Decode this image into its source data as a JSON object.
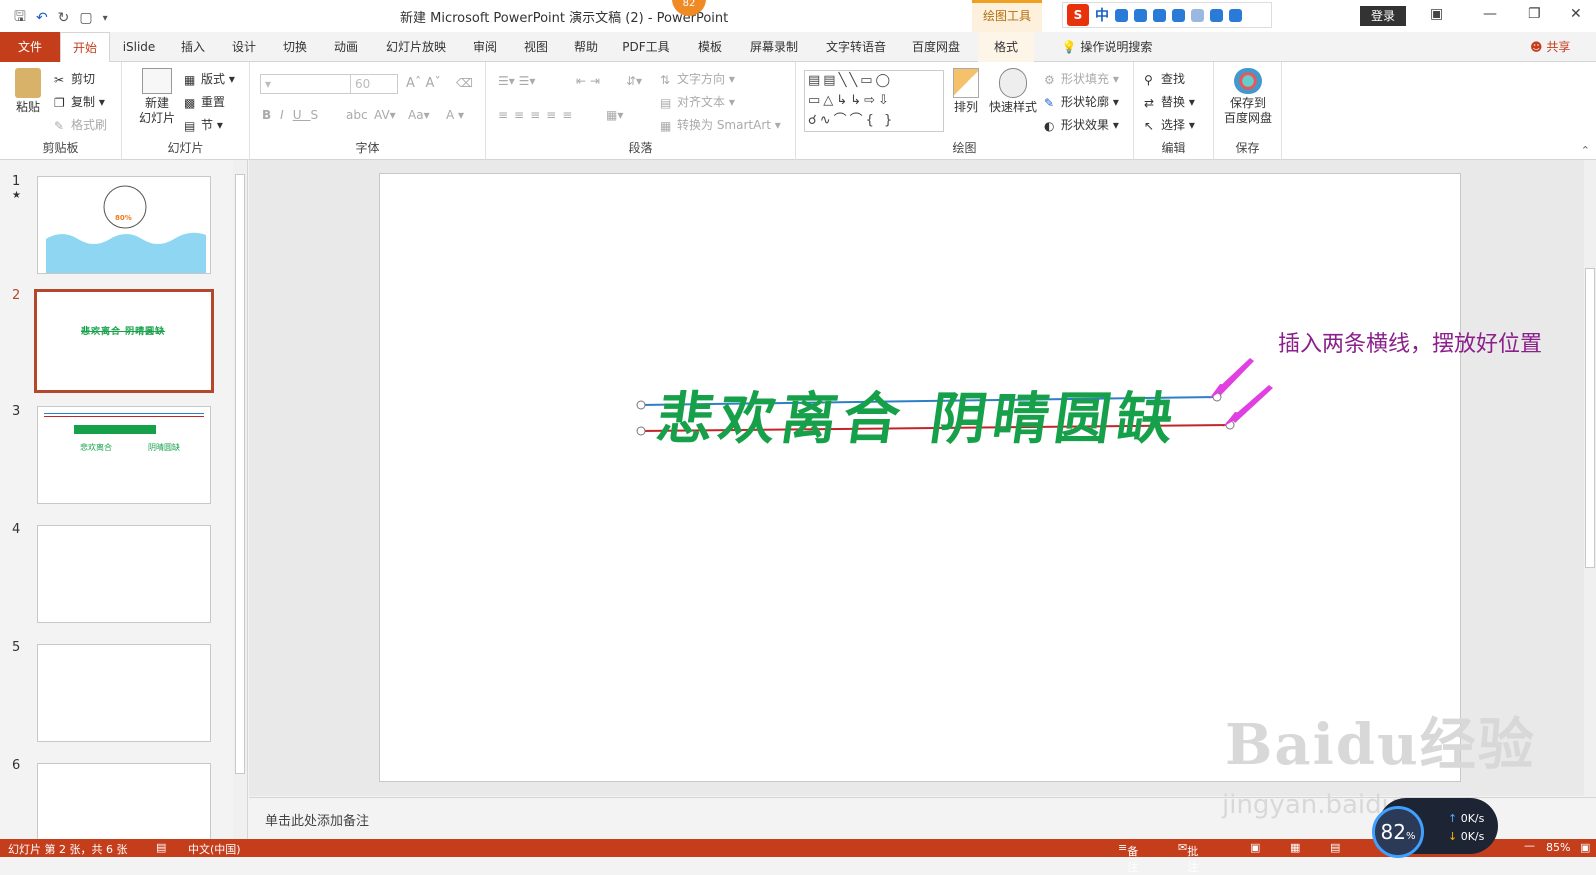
{
  "title_bar": {
    "document_title": "新建 Microsoft PowerPoint 演示文稿 (2)  -  PowerPoint",
    "badge": "82",
    "tool_context_tab": "绘图工具",
    "login_label": "登录",
    "ime_brand": "S",
    "ime_mode": "中"
  },
  "menu": {
    "tabs": [
      "文件",
      "开始",
      "iSlide",
      "插入",
      "设计",
      "切换",
      "动画",
      "幻灯片放映",
      "审阅",
      "视图",
      "帮助",
      "PDF工具",
      "模板",
      "屏幕录制",
      "文字转语音",
      "百度网盘",
      "格式"
    ],
    "active": "开始",
    "tell_me": "操作说明搜索",
    "share": "共享"
  },
  "ribbon": {
    "clipboard": {
      "label": "剪贴板",
      "paste": "粘贴",
      "cut": "剪切",
      "copy": "复制",
      "format_painter": "格式刷"
    },
    "slides": {
      "label": "幻灯片",
      "new_slide": "新建\n幻灯片",
      "layout": "版式",
      "reset": "重置",
      "section": "节"
    },
    "font": {
      "label": "字体",
      "size_value": "60"
    },
    "paragraph": {
      "label": "段落",
      "text_direction": "文字方向",
      "align_text": "对齐文本",
      "convert_smartart": "转换为 SmartArt"
    },
    "drawing": {
      "label": "绘图",
      "arrange": "排列",
      "quick_styles": "快速样式",
      "shape_fill": "形状填充",
      "shape_outline": "形状轮廓",
      "shape_effects": "形状效果"
    },
    "editing": {
      "label": "编辑",
      "find": "查找",
      "replace": "替换",
      "select": "选择"
    },
    "save": {
      "label": "保存",
      "save_to_baidu": "保存到\n百度网盘"
    }
  },
  "thumbnails": [
    {
      "num": "1",
      "star": "★",
      "percent": "80%"
    },
    {
      "num": "2",
      "text": "悲欢离合 阴晴圆缺"
    },
    {
      "num": "3",
      "left": "悲欢离合",
      "right": "阴晴圆缺"
    },
    {
      "num": "4"
    },
    {
      "num": "5"
    },
    {
      "num": "6"
    }
  ],
  "slide": {
    "main_text": "悲欢离合 阴晴圆缺",
    "annotation": "插入两条横线，摆放好位置",
    "colors": {
      "text": "#17a04a",
      "line_top": "#2f7fc4",
      "line_bottom": "#c0252a",
      "annotation": "#8b1f8b",
      "arrow": "#e040e0"
    }
  },
  "notes_placeholder": "单击此处添加备注",
  "status_bar": {
    "slide_info": "幻灯片 第 2 张，共 6 张",
    "language": "中文(中国)",
    "notes": "备注",
    "comments": "批注",
    "zoom": "85%"
  },
  "speed_widget": {
    "percent": "82",
    "unit": "%",
    "up": "0K/s",
    "down": "0K/s"
  },
  "watermark": {
    "line1": "Baidu经验",
    "line2": "jingyan.baidu.com"
  }
}
